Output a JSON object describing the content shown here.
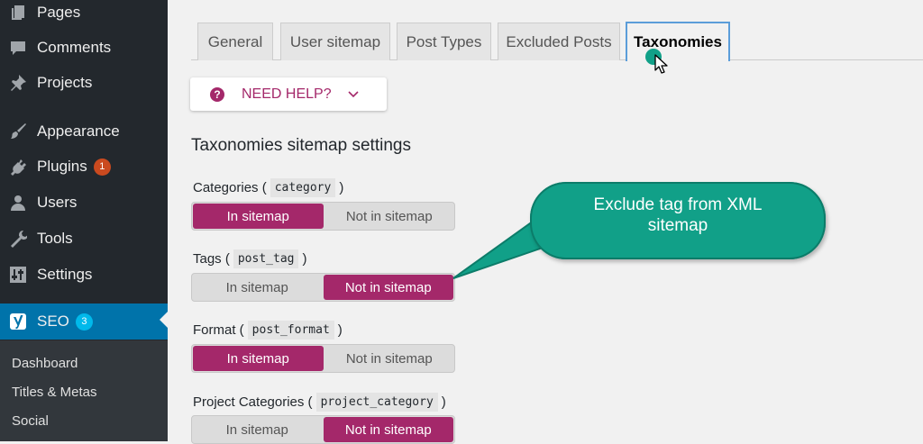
{
  "sidebar": {
    "items": [
      {
        "label": "Pages",
        "icon": "pages-icon"
      },
      {
        "label": "Comments",
        "icon": "comments-icon"
      },
      {
        "label": "Projects",
        "icon": "pin-icon"
      },
      {
        "label": "Appearance",
        "icon": "brush-icon"
      },
      {
        "label": "Plugins",
        "icon": "plugin-icon",
        "badge": "1"
      },
      {
        "label": "Users",
        "icon": "user-icon"
      },
      {
        "label": "Tools",
        "icon": "wrench-icon"
      },
      {
        "label": "Settings",
        "icon": "sliders-icon"
      },
      {
        "label": "SEO",
        "icon": "yoast-icon",
        "badge": "3"
      }
    ],
    "submenu": [
      "Dashboard",
      "Titles & Metas",
      "Social"
    ]
  },
  "tabs": [
    "General",
    "User sitemap",
    "Post Types",
    "Excluded Posts",
    "Taxonomies"
  ],
  "active_tab": "Taxonomies",
  "help": {
    "label": "NEED HELP?"
  },
  "section_title": "Taxonomies sitemap settings",
  "toggle_labels": {
    "on": "In sitemap",
    "off": "Not in sitemap"
  },
  "taxonomies": [
    {
      "label": "Categories (",
      "code": "category",
      "close": ")",
      "selected": "on"
    },
    {
      "label": "Tags (",
      "code": "post_tag",
      "close": ")",
      "selected": "off"
    },
    {
      "label": "Format (",
      "code": "post_format",
      "close": ")",
      "selected": "on"
    },
    {
      "label": "Project Categories (",
      "code": "project_category",
      "close": ")",
      "selected": "off"
    }
  ],
  "callout": {
    "text": "Exclude tag from XML\nsitemap"
  },
  "colors": {
    "accent": "#a4286a",
    "sidebar": "#23282d",
    "seo_active": "#0073aa",
    "callout": "#11a088"
  }
}
